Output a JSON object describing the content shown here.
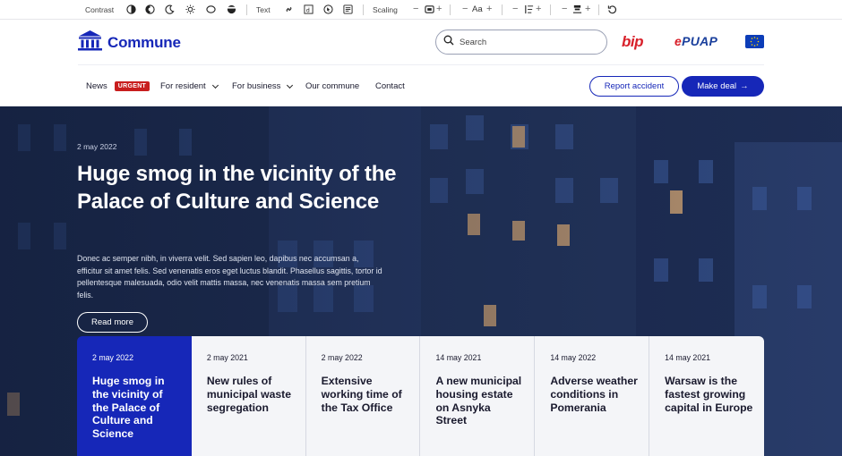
{
  "toolbar": {
    "contrast_label": "Contrast",
    "text_label": "Text",
    "scaling_label": "Scaling",
    "font_size_label": "Aa",
    "minus": "−",
    "plus": "+"
  },
  "header": {
    "logo_text": "Commune",
    "search_placeholder": "Search",
    "bip_label": "bip",
    "epuap_prefix": "e",
    "epuap_label": "PUAP"
  },
  "nav": {
    "items": [
      {
        "label": "News",
        "badge": "URGENT"
      },
      {
        "label": "For resident"
      },
      {
        "label": "For business"
      },
      {
        "label": "Our commune"
      },
      {
        "label": "Contact"
      }
    ],
    "report_button": "Report accident",
    "deal_button": "Make deal",
    "deal_arrow": "→"
  },
  "hero": {
    "date": "2 may 2022",
    "title": "Huge smog in the vicinity of the Palace of Culture and Science",
    "text": "Donec ac semper nibh, in viverra velit. Sed sapien leo, dapibus nec accumsan a, efficitur sit amet felis. Sed venenatis eros eget luctus blandit. Phasellus sagittis, tortor id pellentesque malesuada, odio velit mattis massa, nec venenatis massa sem pretium felis.",
    "read_more": "Read more"
  },
  "cards": [
    {
      "date": "2 may 2022",
      "title": "Huge smog in the vicinity of the Palace of Culture and Science"
    },
    {
      "date": "2 may 2021",
      "title": "New rules of municipal waste segregation"
    },
    {
      "date": "2 may 2022",
      "title": "Extensive working time of the Tax Office"
    },
    {
      "date": "14 may 2021",
      "title": "A new municipal housing estate on Asnyka Street"
    },
    {
      "date": "14 may 2022",
      "title": "Adverse weather conditions in Pomerania"
    },
    {
      "date": "14 may 2021",
      "title": "Warsaw is the fastest growing capital in Europe"
    }
  ],
  "colors": {
    "brand": "#1627b8",
    "urgent": "#c81e1e",
    "bip": "#d8202a"
  }
}
